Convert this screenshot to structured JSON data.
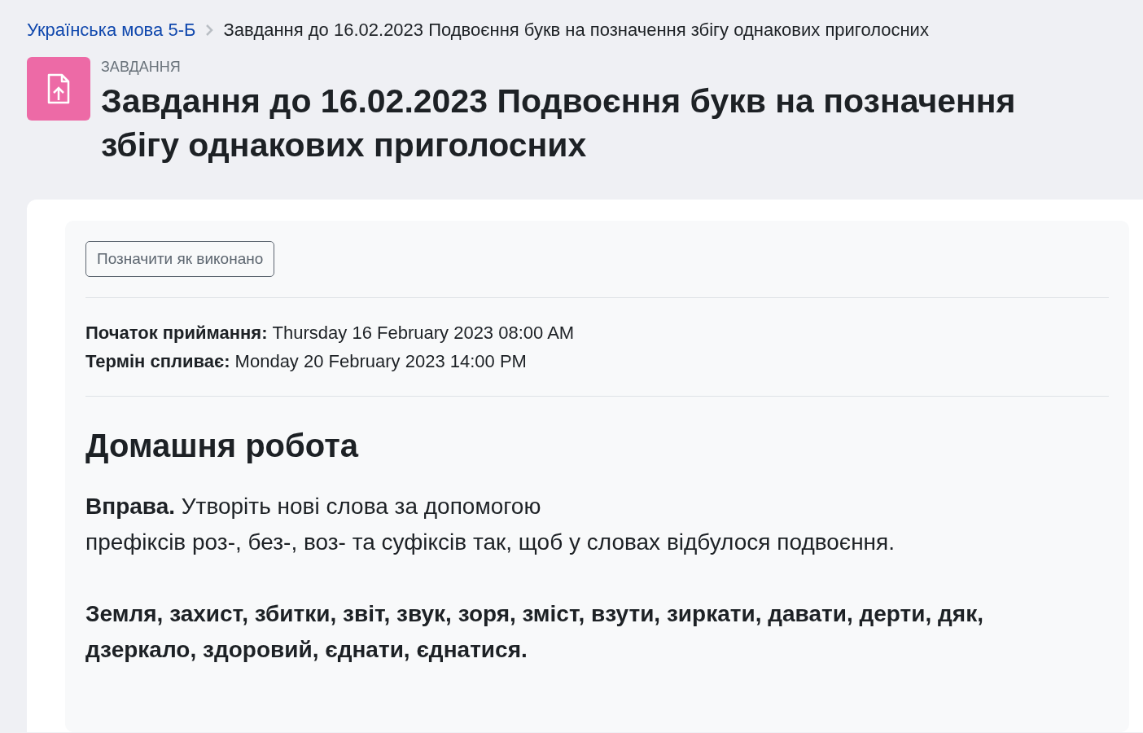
{
  "breadcrumb": [
    {
      "label": "Українська мова 5-Б",
      "kind": "link"
    },
    {
      "label": "Завдання до 16.02.2023 Подвоєння букв на позначення збігу однакових приголосних",
      "kind": "current"
    }
  ],
  "header": {
    "category": "ЗАВДАННЯ",
    "title": "Завдання до 16.02.2023 Подвоєння букв на позначення збігу однакових приголосних"
  },
  "completion_button": {
    "label": "Позначити як виконано",
    "checked": false
  },
  "dates": [
    "**Початок приймання:** Thursday 16 February 2023 08:00 AM",
    "**Термін спливає:** Monday 20 February 2023 14:00 PM"
  ],
  "description": {
    "heading": "Домашня робота",
    "exercise_lines": [
      "**Вправа.** Утворіть нові слова за допомогою",
      "префіксів роз-, без-, воз- та суфіксів так, щоб у словах відбулося подвоєння."
    ],
    "word_lines": [
      "Земля, захист, збитки, звіт, звук, зоря, зміст, взути, зиркати, давати, дерти, дяк,",
      "дзеркало, здоровий, єднати, єднатися."
    ]
  }
}
